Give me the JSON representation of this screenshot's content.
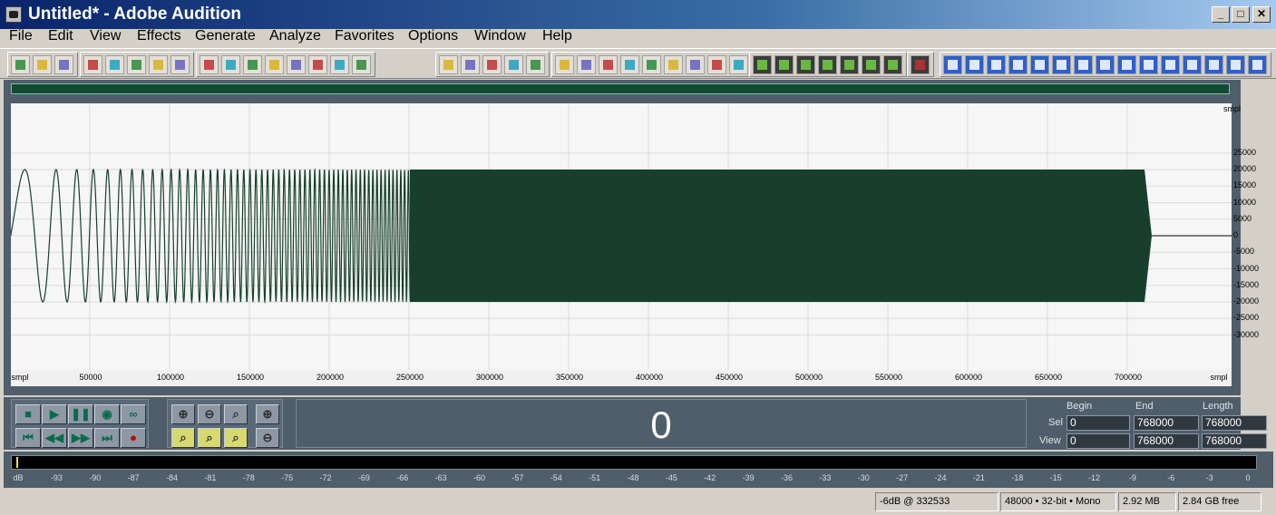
{
  "window": {
    "title": "Untitled* - Adobe Audition",
    "minimize": "_",
    "maximize": "□",
    "close": "✕"
  },
  "menu": [
    "File",
    "Edit",
    "View",
    "Effects",
    "Generate",
    "Analyze",
    "Favorites",
    "Options",
    "Window",
    "Help"
  ],
  "toolbar": {
    "icons": [
      "edit-view-icon",
      "multitrack-view-icon",
      "cd-view-icon",
      "new-icon",
      "open-icon",
      "save-icon",
      "save-as-icon",
      "save-all-icon",
      "undo-icon",
      "redo-icon",
      "repeat-icon",
      "copy-icon",
      "copy-new-icon",
      "cut-icon",
      "paste-icon",
      "paste-new-icon",
      "mix-paste-icon",
      "trim-icon",
      "zero-cross-icon",
      "snap-icon",
      "mark-icon",
      "region-icon",
      "cue-icon",
      "info-icon",
      "grid-icon",
      "play-icon",
      "zoom-icon",
      "time-display-icon",
      "stats-icon",
      "frequency-icon",
      "spectral-icon",
      "effect-1-icon",
      "effect-2-icon",
      "effect-3-icon",
      "effect-4-icon",
      "effect-5-icon",
      "effect-6-icon",
      "effect-7-icon",
      "monitor-icon",
      "ap-icon",
      "ap42-icon",
      "mc-icon",
      "vp-icon",
      "fx-1-icon",
      "fx-2-icon",
      "fx-3-icon",
      "fx-4-icon",
      "fx-5-icon",
      "fx-6-icon",
      "itu-icon",
      "st-icon",
      "fx-7-icon"
    ]
  },
  "waveform": {
    "amplitude_unit": "smpl",
    "amplitude_ticks": [
      "25000",
      "20000",
      "15000",
      "10000",
      "5000",
      "0",
      "-5000",
      "-10000",
      "-15000",
      "-20000",
      "-25000",
      "-30000"
    ],
    "time_unit": "smpl",
    "time_ticks": [
      "50000",
      "100000",
      "150000",
      "200000",
      "250000",
      "300000",
      "350000",
      "400000",
      "450000",
      "500000",
      "550000",
      "600000",
      "650000",
      "700000"
    ],
    "description_note": "",
    "colors": {
      "background": "#f6f6f6",
      "wave": "#173f2c",
      "grid": "#d8dcd8"
    }
  },
  "transport": {
    "buttons": [
      {
        "name": "stop-button",
        "icon": "■"
      },
      {
        "name": "play-button",
        "icon": "▶"
      },
      {
        "name": "pause-button",
        "icon": "❚❚"
      },
      {
        "name": "play-to-end-button",
        "icon": "◉"
      },
      {
        "name": "loop-button",
        "icon": "∞"
      },
      {
        "name": "go-to-beginning-button",
        "icon": "⏮"
      },
      {
        "name": "rewind-button",
        "icon": "◀◀"
      },
      {
        "name": "fast-forward-button",
        "icon": "▶▶"
      },
      {
        "name": "go-to-end-button",
        "icon": "⏭"
      },
      {
        "name": "record-button",
        "icon": "●"
      }
    ],
    "zoom_buttons": [
      "zoom-in-horizontal",
      "zoom-out-horizontal",
      "zoom-full",
      "zoom-in-vertical",
      "zoom-to-left",
      "zoom-selection",
      "zoom-to-right",
      "zoom-out-vertical"
    ]
  },
  "time_display": "0",
  "selection": {
    "headers": {
      "begin": "Begin",
      "end": "End",
      "length": "Length"
    },
    "sel_label": "Sel",
    "view_label": "View",
    "sel": {
      "begin": "0",
      "end": "768000",
      "length": "768000"
    },
    "view": {
      "begin": "0",
      "end": "768000",
      "length": "768000"
    }
  },
  "meter": {
    "ticks": [
      "dB",
      "-93",
      "-90",
      "-87",
      "-84",
      "-81",
      "-78",
      "-75",
      "-72",
      "-69",
      "-66",
      "-63",
      "-60",
      "-57",
      "-54",
      "-51",
      "-48",
      "-45",
      "-42",
      "-39",
      "-36",
      "-33",
      "-30",
      "-27",
      "-24",
      "-21",
      "-18",
      "-15",
      "-12",
      "-9",
      "-6",
      "-3",
      "0"
    ]
  },
  "status": {
    "peak": "-6dB @ 332533",
    "format": "48000 • 32-bit • Mono",
    "size": "2.92 MB",
    "free": "2.84 GB free"
  }
}
